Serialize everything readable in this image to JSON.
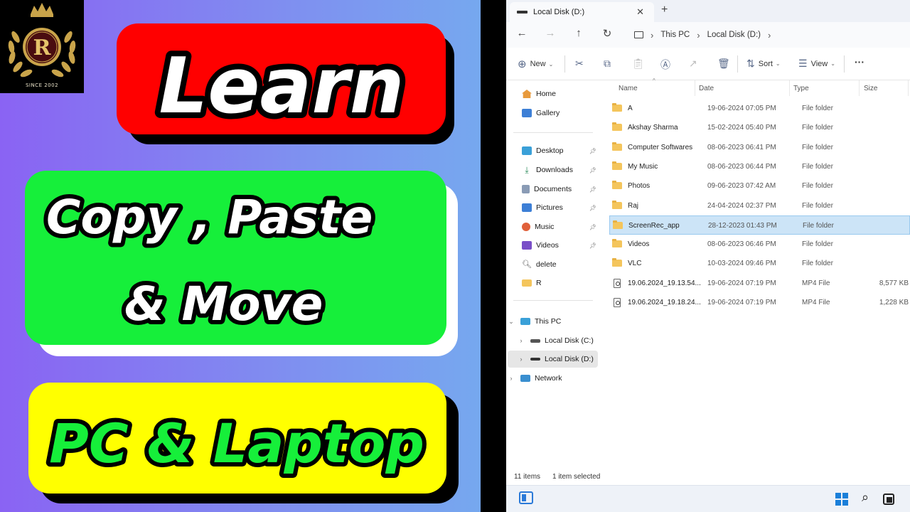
{
  "thumbnail": {
    "logo_letter": "R",
    "logo_since": "SINCE 2002",
    "line1": "Learn",
    "line2a": "Copy , Paste",
    "line2b": "& Move",
    "line3": "PC & Laptop",
    "colors": {
      "red": "#ff0000",
      "green": "#16ef3a",
      "yellow": "#ffff00",
      "bg_left": "#8a63f3",
      "bg_right": "#76a8ef"
    }
  },
  "explorer": {
    "tab_title": "Local Disk (D:)",
    "breadcrumb": [
      "This PC",
      "Local Disk (D:)"
    ],
    "toolbar": {
      "new_label": "New",
      "sort_label": "Sort",
      "view_label": "View"
    },
    "nav": {
      "quick": [
        {
          "label": "Home",
          "icon": "home-icon"
        },
        {
          "label": "Gallery",
          "icon": "gallery-icon"
        }
      ],
      "pinned": [
        {
          "label": "Desktop",
          "icon": "desktop-icon"
        },
        {
          "label": "Downloads",
          "icon": "downloads-icon"
        },
        {
          "label": "Documents",
          "icon": "documents-icon"
        },
        {
          "label": "Pictures",
          "icon": "pictures-icon"
        },
        {
          "label": "Music",
          "icon": "music-icon"
        },
        {
          "label": "Videos",
          "icon": "videos-icon"
        },
        {
          "label": "delete",
          "icon": "search-icon"
        },
        {
          "label": "R",
          "icon": "folder-icon"
        }
      ],
      "tree": [
        {
          "label": "This PC",
          "icon": "pc-icon"
        },
        {
          "label": "Local Disk (C:)",
          "icon": "drive-icon"
        },
        {
          "label": "Local Disk (D:)",
          "icon": "drive-icon"
        },
        {
          "label": "Network",
          "icon": "network-icon"
        }
      ]
    },
    "columns": {
      "name": "Name",
      "date": "Date",
      "type": "Type",
      "size": "Size"
    },
    "files": [
      {
        "name": "A",
        "date": "19-06-2024 07:05 PM",
        "type": "File folder",
        "size": ""
      },
      {
        "name": "Akshay Sharma",
        "date": "15-02-2024 05:40 PM",
        "type": "File folder",
        "size": ""
      },
      {
        "name": "Computer Softwares",
        "date": "08-06-2023 06:41 PM",
        "type": "File folder",
        "size": ""
      },
      {
        "name": "My Music",
        "date": "08-06-2023 06:44 PM",
        "type": "File folder",
        "size": ""
      },
      {
        "name": "Photos",
        "date": "09-06-2023 07:42 AM",
        "type": "File folder",
        "size": ""
      },
      {
        "name": "Raj",
        "date": "24-04-2024 02:37 PM",
        "type": "File folder",
        "size": ""
      },
      {
        "name": "ScreenRec_app",
        "date": "28-12-2023 01:43 PM",
        "type": "File folder",
        "size": ""
      },
      {
        "name": "Videos",
        "date": "08-06-2023 06:46 PM",
        "type": "File folder",
        "size": ""
      },
      {
        "name": "VLC",
        "date": "10-03-2024 09:46 PM",
        "type": "File folder",
        "size": ""
      },
      {
        "name": "19.06.2024_19.13.54...",
        "date": "19-06-2024 07:19 PM",
        "type": "MP4 File",
        "size": "8,577 KB"
      },
      {
        "name": "19.06.2024_19.18.24...",
        "date": "19-06-2024 07:19 PM",
        "type": "MP4 File",
        "size": "1,228 KB"
      }
    ],
    "selected_file": "ScreenRec_app",
    "status": {
      "count": "11 items",
      "selection": "1 item selected"
    }
  }
}
